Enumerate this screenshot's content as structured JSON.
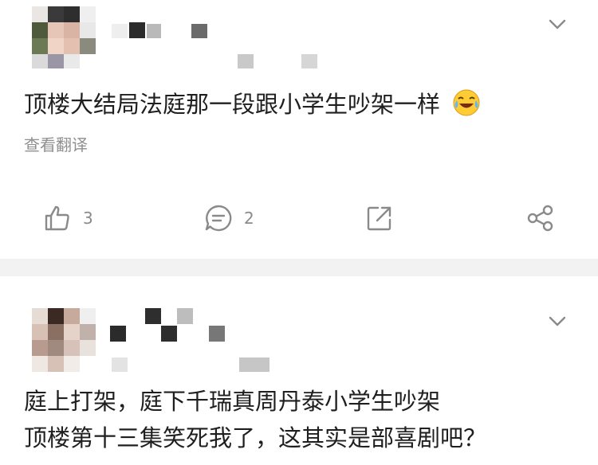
{
  "comments": [
    {
      "text_lines": [
        "顶楼大结局法庭那一段跟小学生吵架一样"
      ],
      "emoji": "laughing-crying-emoji",
      "translate_label": "查看翻译",
      "actions": {
        "like_count": "3",
        "comment_count": "2"
      }
    },
    {
      "text_lines": [
        "庭上打架，庭下千瑞真周丹泰小学生吵架",
        "顶楼第十三集笑死我了，这其实是部喜剧吧？"
      ]
    }
  ],
  "colors": {
    "icon": "#8a8a8a",
    "divider": "#f2f2f2",
    "meta_text": "#8f8f8f"
  },
  "icons": [
    "chevron-down-icon",
    "thumbs-up-icon",
    "comment-icon",
    "share-link-icon",
    "share-icon"
  ]
}
